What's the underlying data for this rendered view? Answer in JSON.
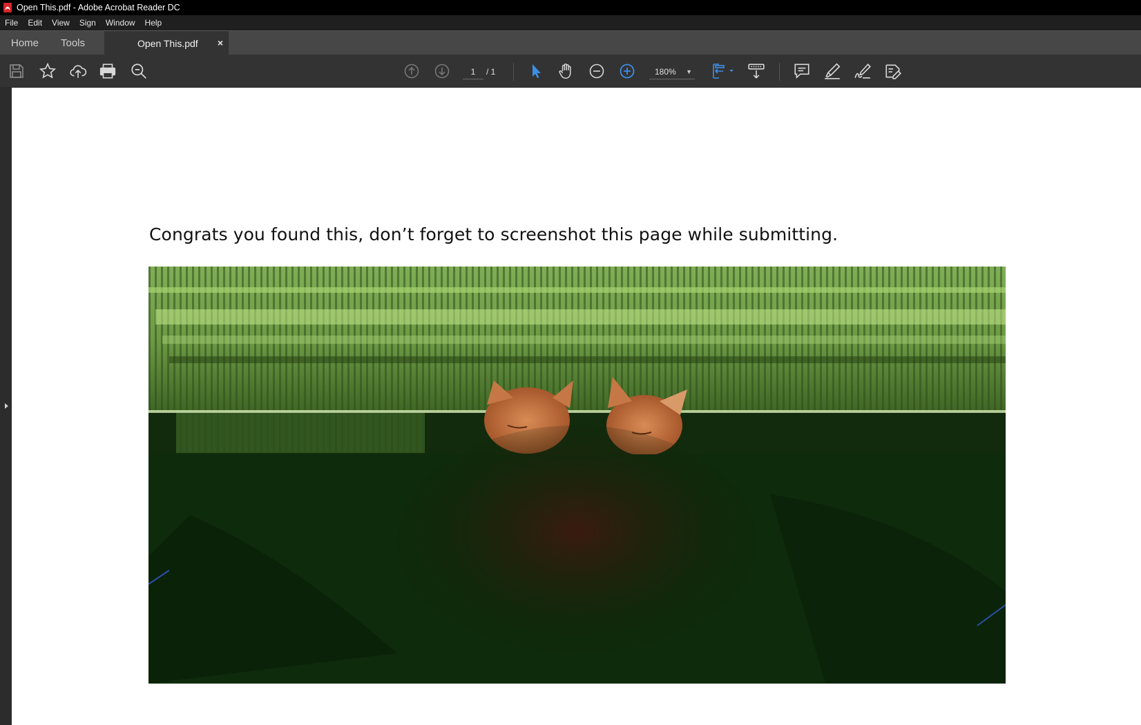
{
  "window": {
    "title": "Open This.pdf - Adobe Acrobat Reader DC"
  },
  "menu": [
    "File",
    "Edit",
    "View",
    "Sign",
    "Window",
    "Help"
  ],
  "tabs": {
    "home": "Home",
    "tools": "Tools",
    "document": "Open This.pdf",
    "close": "×"
  },
  "toolbar": {
    "current_page": "1",
    "total_pages": "/ 1",
    "zoom": "180%",
    "icons": [
      "save-icon",
      "bookmark-star-icon",
      "upload-cloud-icon",
      "print-icon",
      "find-zoom-icon",
      "page-up-icon",
      "page-down-icon",
      "select-cursor-icon",
      "hand-tool-icon",
      "zoom-out-icon",
      "zoom-in-icon",
      "fit-page-icon",
      "scroll-mode-icon",
      "comment-icon",
      "highlight-icon",
      "sign-icon",
      "fill-sign-icon"
    ]
  },
  "document": {
    "text": "Congrats you found this, don’t forget to screenshot this page while submitting.",
    "image": "glitched photo of two orange cats with green tint"
  },
  "colors": {
    "accent": "#3d8fe6",
    "toolbar_bg": "#333333",
    "tabbar_bg": "#474747"
  }
}
